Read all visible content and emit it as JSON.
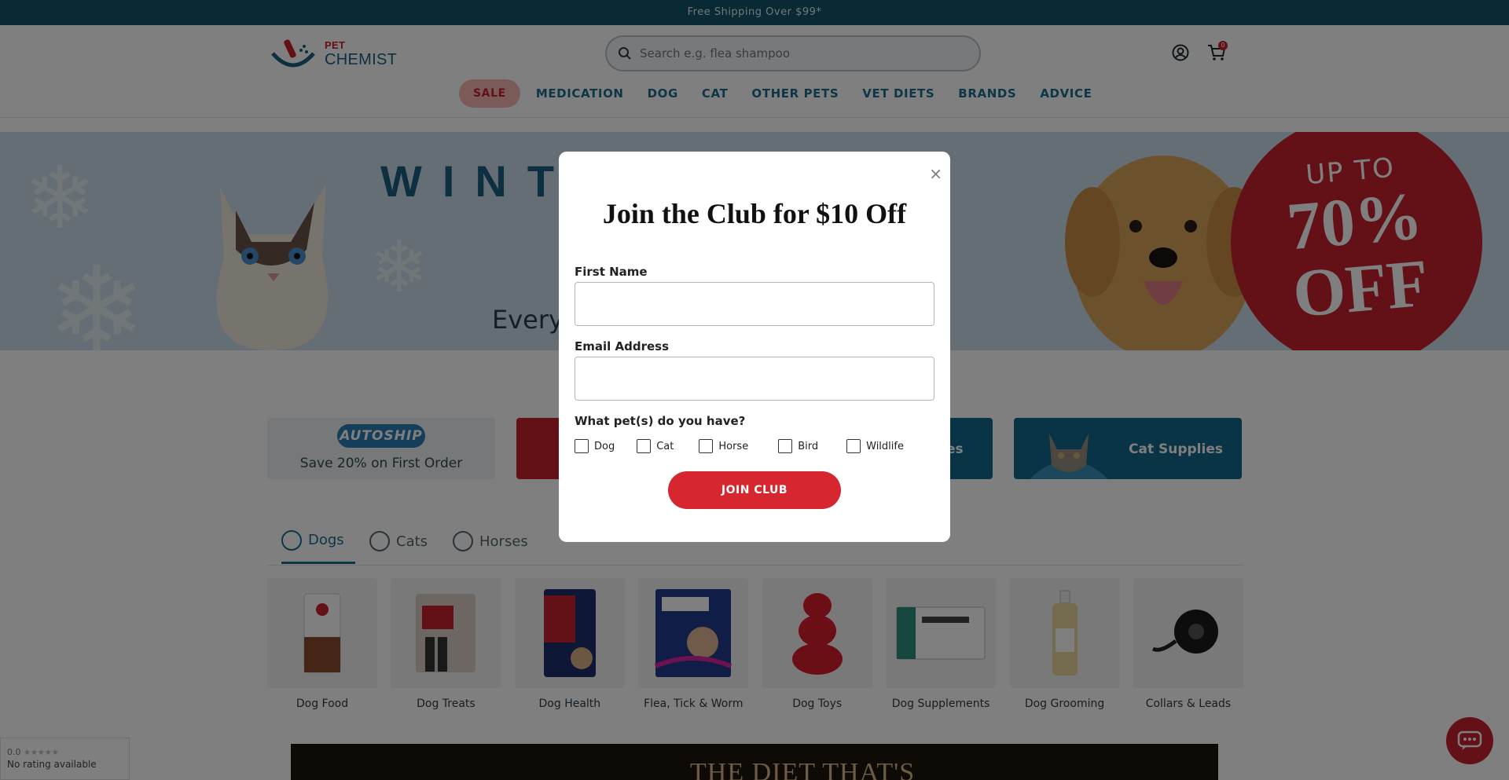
{
  "topbar": {
    "text": "Free Shipping Over $99*"
  },
  "logo": {
    "pet": "PET",
    "chemist": "CHEMIST"
  },
  "search": {
    "placeholder": "Search e.g. flea shampoo"
  },
  "cart": {
    "count": "0"
  },
  "nav": {
    "sale": "SALE",
    "items": [
      "MEDICATION",
      "DOG",
      "CAT",
      "OTHER PETS",
      "VET DIETS",
      "BRANDS",
      "ADVICE"
    ]
  },
  "hero": {
    "title": "WINTE          AND",
    "subtitle": "Every                                     s",
    "badge": {
      "upto": "UP TO",
      "percent": "70%",
      "off": "OFF"
    }
  },
  "promos": {
    "autoship_logo": "AUTOSHIP",
    "autoship_text": "Save 20% on First Order",
    "blue_partial": "es",
    "cat_supplies": "Cat Supplies"
  },
  "tabs": [
    "Dogs",
    "Cats",
    "Horses"
  ],
  "categories": [
    "Dog Food",
    "Dog Treats",
    "Dog Health",
    "Flea, Tick & Worm",
    "Dog Toys",
    "Dog Supplements",
    "Dog Grooming",
    "Collars & Leads"
  ],
  "bottom_banner": {
    "text": "THE DIET THAT'S"
  },
  "rating": {
    "score": "0.0",
    "stars": "★★★★★",
    "text": "No rating available"
  },
  "modal": {
    "title": "Join the Club for $10 Off",
    "close": "×",
    "first_name_label": "First Name",
    "email_label": "Email Address",
    "pets_question": "What pet(s) do you have?",
    "pets": [
      "Dog",
      "Cat",
      "Horse",
      "Bird",
      "Wildlife"
    ],
    "submit": "JOIN CLUB"
  },
  "colors": {
    "brand_teal": "#13536b",
    "brand_red": "#c8202f",
    "nav_blue": "#1a6c8c"
  }
}
